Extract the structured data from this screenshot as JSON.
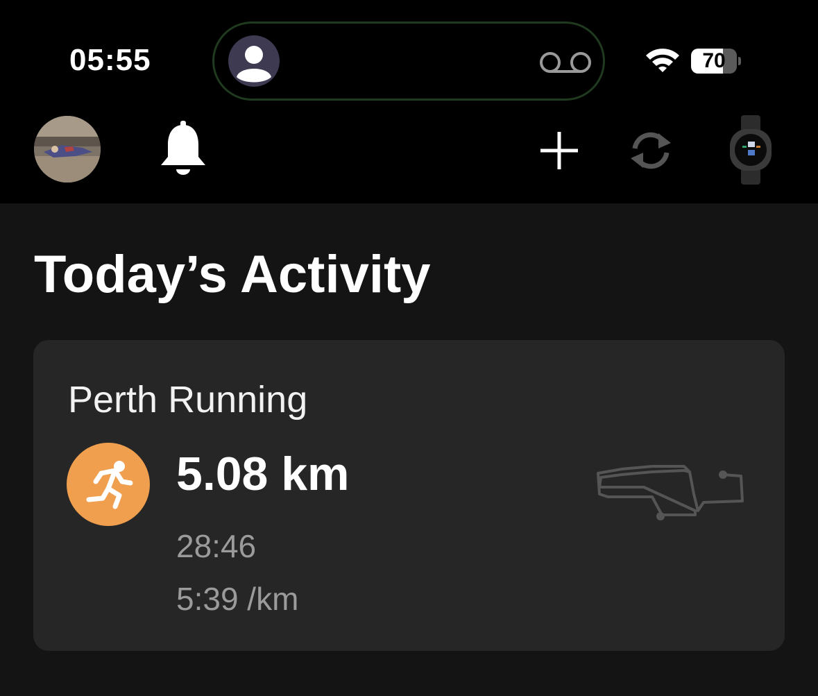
{
  "status_bar": {
    "time": "05:55",
    "battery_level": "70",
    "battery_fraction": 0.7,
    "icons": [
      "contact-avatar-icon",
      "voicemail-icon",
      "wifi-icon",
      "battery-icon"
    ]
  },
  "header": {
    "icons": [
      "profile-avatar",
      "bell-icon",
      "add-icon",
      "sync-icon",
      "watch-icon"
    ]
  },
  "main": {
    "title": "Today’s Activity",
    "activity": {
      "name": "Perth Running",
      "icon": "running-icon",
      "distance": "5.08 km",
      "duration": "28:46",
      "pace": "5:39 /km"
    }
  },
  "colors": {
    "background": "#141414",
    "header_background": "#000000",
    "card_background": "#262626",
    "activity_accent": "#ef9f4e",
    "secondary_text": "#9b9b9b"
  }
}
